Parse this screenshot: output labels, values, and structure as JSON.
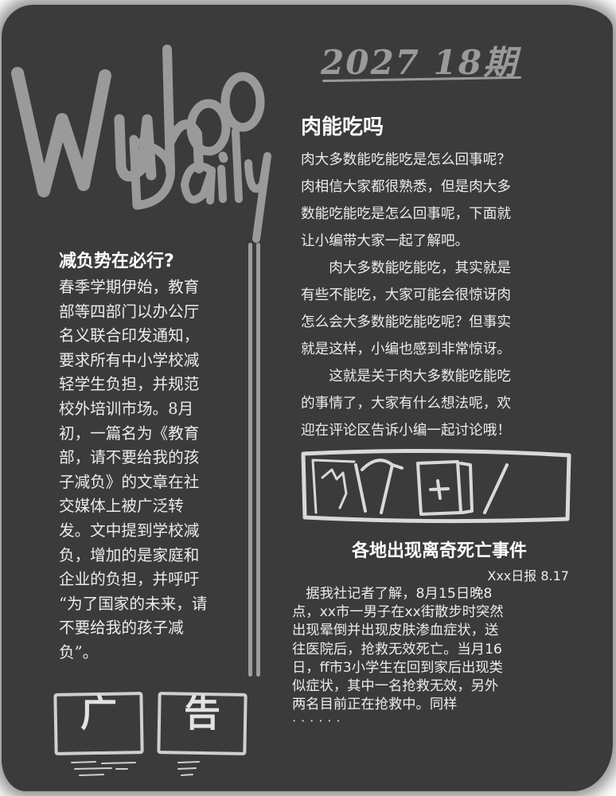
{
  "masthead": {
    "logo_line1": "Wuhoo",
    "logo_line2": "Daily",
    "issue": "2027  18期"
  },
  "left_article": {
    "headline": "减负势在必行?",
    "lines": [
      "春季学期伊始，教育",
      "部等四部门以办公厅",
      "名义联合印发通知，",
      "要求所有中小学校减",
      "轻学生负担，并规范",
      "校外培训市场。8月",
      "初，一篇名为《教育",
      "部，请不要给我的孩",
      "子减负》的文章在社",
      "交媒体上被广泛转",
      "发。文中提到学校减",
      "负，增加的是家庭和",
      "企业的负担，并呼吁",
      "“为了国家的未来，请",
      "不要给我的孩子减",
      "负”。"
    ]
  },
  "right_article": {
    "headline": "肉能吃吗",
    "p1_lines": [
      "肉大多数能吃能吃是怎么回事呢？",
      "肉相信大家都很熟悉，但是肉大多",
      "数能吃能吃是怎么回事呢，下面就",
      "让小编带大家一起了解吧。"
    ],
    "p2_lines": [
      "肉大多数能吃能吃，其实就是",
      "有些不能吃，大家可能会很惊讶肉",
      "怎么会大多数能吃能吃呢？但事实",
      "就是这样，小编也感到非常惊讶。"
    ],
    "p3_lines": [
      "这就是关于肉大多数能吃能吃",
      "的事情了，大家有什么想法呢，欢",
      "迎在评论区告诉小编一起讨论哦！"
    ]
  },
  "news": {
    "headline": "各地出现离奇死亡事件",
    "byline": "Xxx日报 8.17",
    "lines": [
      "据我社记者了解，8月15日晚8",
      "点，xx市一男子在xx街散步时突然",
      "出现晕倒并出现皮肤渗血症状，送",
      "往医院后，抢救无效死亡。当月16",
      "日，ff市3小学生在回到家后出现类",
      "似症状，其中一名抢救无效，另外",
      "两名目前正在抢救中。同样"
    ],
    "dots": "······"
  },
  "ad": {
    "char1": "广",
    "char2": "告"
  },
  "colors": {
    "board": "#3b3b3b",
    "chalk": "#9a9a9a",
    "text": "#ececec"
  }
}
